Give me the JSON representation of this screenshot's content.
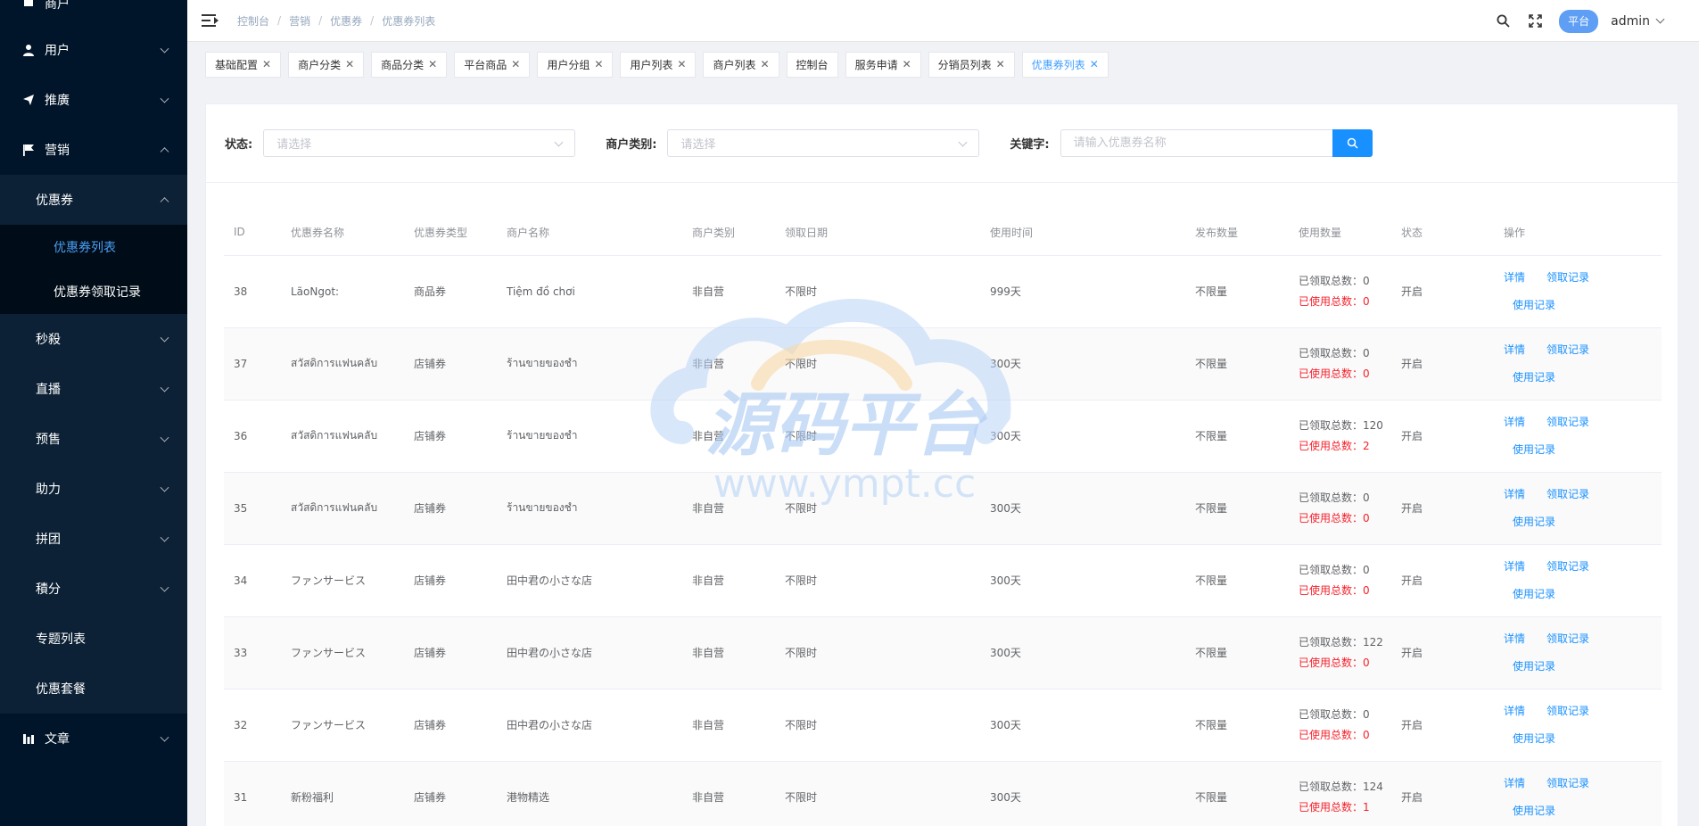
{
  "sidebar": {
    "top_partial_label": "商户",
    "menus": [
      {
        "label": "用户"
      },
      {
        "label": "推廣"
      },
      {
        "label": "营销"
      }
    ],
    "marketing_children": [
      {
        "label": "优惠券"
      },
      {
        "label": "秒殺"
      },
      {
        "label": "直播"
      },
      {
        "label": "预售"
      },
      {
        "label": "助力"
      },
      {
        "label": "拼团"
      },
      {
        "label": "積分"
      },
      {
        "label": "专题列表"
      },
      {
        "label": "优惠套餐"
      }
    ],
    "coupon_children": [
      {
        "label": "优惠券列表"
      },
      {
        "label": "优惠券领取记录"
      }
    ],
    "bottom_menu": {
      "label": "文章"
    }
  },
  "header": {
    "breadcrumb": [
      "控制台",
      "营销",
      "优惠券",
      "优惠券列表"
    ],
    "role_badge": "平台",
    "user": "admin"
  },
  "tags": [
    {
      "label": "基础配置",
      "closable": true
    },
    {
      "label": "商户分类",
      "closable": true
    },
    {
      "label": "商品分类",
      "closable": true
    },
    {
      "label": "平台商品",
      "closable": true
    },
    {
      "label": "用户分组",
      "closable": true
    },
    {
      "label": "用户列表",
      "closable": true
    },
    {
      "label": "商户列表",
      "closable": true
    },
    {
      "label": "控制台",
      "closable": false
    },
    {
      "label": "服务申请",
      "closable": true
    },
    {
      "label": "分销员列表",
      "closable": true
    },
    {
      "label": "优惠券列表",
      "closable": true,
      "active": true
    }
  ],
  "filters": {
    "status_label": "状态:",
    "status_placeholder": "请选择",
    "merchant_type_label": "商户类别:",
    "merchant_type_placeholder": "请选择",
    "keyword_label": "关键字:",
    "keyword_placeholder": "请输入优惠券名称"
  },
  "table": {
    "columns": [
      "ID",
      "优惠券名称",
      "优惠券类型",
      "商户名称",
      "商户类别",
      "领取日期",
      "使用时间",
      "发布数量",
      "使用数量",
      "状态",
      "操作"
    ],
    "received_prefix": "已领取总数：",
    "used_prefix": "已使用总数：",
    "actions": [
      "详情",
      "领取记录",
      "使用记录"
    ],
    "rows": [
      {
        "id": "38",
        "name": "LãoNgot:",
        "type": "商品券",
        "merchant": "Tiệm đồ chơi",
        "category": "非自营",
        "claim_date": "不限时",
        "use_time": "999天",
        "issued": "不限量",
        "received": "0",
        "used": "0",
        "status": "开启"
      },
      {
        "id": "37",
        "name": "สวัสดิการแฟนคลับ",
        "type": "店铺券",
        "merchant": "ร้านขายของชำ",
        "category": "非自营",
        "claim_date": "不限时",
        "use_time": "300天",
        "issued": "不限量",
        "received": "0",
        "used": "0",
        "status": "开启"
      },
      {
        "id": "36",
        "name": "สวัสดิการแฟนคลับ",
        "type": "店铺券",
        "merchant": "ร้านขายของชำ",
        "category": "非自营",
        "claim_date": "不限时",
        "use_time": "300天",
        "issued": "不限量",
        "received": "120",
        "used": "2",
        "status": "开启"
      },
      {
        "id": "35",
        "name": "สวัสดิการแฟนคลับ",
        "type": "店铺券",
        "merchant": "ร้านขายของชำ",
        "category": "非自营",
        "claim_date": "不限时",
        "use_time": "300天",
        "issued": "不限量",
        "received": "0",
        "used": "0",
        "status": "开启"
      },
      {
        "id": "34",
        "name": "ファンサービス",
        "type": "店铺券",
        "merchant": "田中君の小さな店",
        "category": "非自营",
        "claim_date": "不限时",
        "use_time": "300天",
        "issued": "不限量",
        "received": "0",
        "used": "0",
        "status": "开启"
      },
      {
        "id": "33",
        "name": "ファンサービス",
        "type": "店铺券",
        "merchant": "田中君の小さな店",
        "category": "非自营",
        "claim_date": "不限时",
        "use_time": "300天",
        "issued": "不限量",
        "received": "122",
        "used": "0",
        "status": "开启"
      },
      {
        "id": "32",
        "name": "ファンサービス",
        "type": "店铺券",
        "merchant": "田中君の小さな店",
        "category": "非自营",
        "claim_date": "不限时",
        "use_time": "300天",
        "issued": "不限量",
        "received": "0",
        "used": "0",
        "status": "开启"
      },
      {
        "id": "31",
        "name": "新粉福利",
        "type": "店铺券",
        "merchant": "港物精选",
        "category": "非自营",
        "claim_date": "不限时",
        "use_time": "300天",
        "issued": "不限量",
        "received": "124",
        "used": "1",
        "status": "开启"
      }
    ]
  },
  "watermark": {
    "title": "源码平台",
    "url": "www.ympt.cc"
  },
  "colors": {
    "sidebar_bg": "#001529",
    "accent": "#1890ff",
    "danger": "#f5222d",
    "badge": "#5e9ef5"
  }
}
